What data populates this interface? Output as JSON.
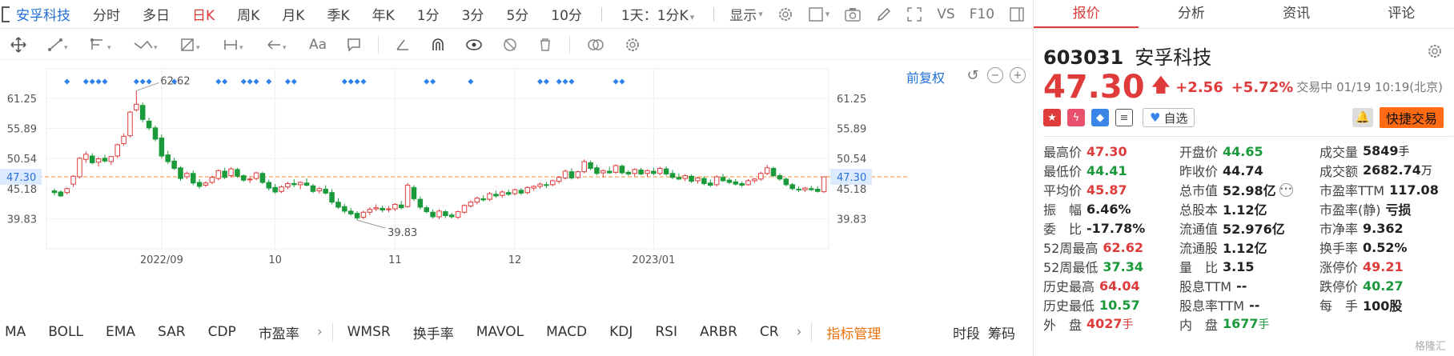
{
  "stock_tab": "安孚科技",
  "periods": [
    "分时",
    "多日",
    "日K",
    "周K",
    "月K",
    "季K",
    "年K",
    "1分",
    "3分",
    "5分",
    "10分",
    "1天：1分K"
  ],
  "active_period": "日K",
  "display_label": "显示",
  "vs_label": "VS",
  "f10_label": "F10",
  "draw_tools": {
    "text_label": "Aa"
  },
  "adj_label": "前复权",
  "indicators": [
    "MA",
    "BOLL",
    "EMA",
    "SAR",
    "CDP",
    "市盈率"
  ],
  "indicators2": [
    "WMSR",
    "换手率",
    "MAVOL",
    "MACD",
    "KDJ",
    "RSI",
    "ARBR",
    "CR"
  ],
  "indicator_manage": "指标管理",
  "bottom_right": [
    "时段",
    "筹码"
  ],
  "right_tabs": [
    "报价",
    "分析",
    "资讯",
    "评论"
  ],
  "quote": {
    "code": "603031",
    "name": "安孚科技",
    "price": "47.30",
    "change": "+2.56",
    "pct": "+5.72%",
    "status": "交易中 01/19 10:19(北京)",
    "favorite": "自选",
    "quick_trade": "快捷交易"
  },
  "stats": [
    [
      {
        "l": "最高价",
        "v": "47.30",
        "c": "red"
      },
      {
        "l": "开盘价",
        "v": "44.65",
        "c": "green"
      },
      {
        "l": "成交量",
        "v": "5849",
        "u": "手"
      }
    ],
    [
      {
        "l": "最低价",
        "v": "44.41",
        "c": "green"
      },
      {
        "l": "昨收价",
        "v": "44.74"
      },
      {
        "l": "成交额",
        "v": "2682.74",
        "u": "万"
      }
    ],
    [
      {
        "l": "平均价",
        "v": "45.87",
        "c": "red"
      },
      {
        "l": "总市值",
        "v": "52.98亿",
        "more": true
      },
      {
        "l": "市盈率TTM",
        "v": "117.08"
      }
    ],
    [
      {
        "l": "振　幅",
        "v": "6.46%"
      },
      {
        "l": "总股本",
        "v": "1.12亿"
      },
      {
        "l": "市盈率(静)",
        "v": "亏损"
      }
    ],
    [
      {
        "l": "委　比",
        "v": "-17.78%"
      },
      {
        "l": "流通值",
        "v": "52.976亿"
      },
      {
        "l": "市净率",
        "v": "9.362"
      }
    ],
    [
      {
        "l": "52周最高",
        "v": "62.62",
        "c": "red"
      },
      {
        "l": "流通股",
        "v": "1.12亿"
      },
      {
        "l": "换手率",
        "v": "0.52%"
      }
    ],
    [
      {
        "l": "52周最低",
        "v": "37.34",
        "c": "green"
      },
      {
        "l": "量　比",
        "v": "3.15"
      },
      {
        "l": "涨停价",
        "v": "49.21",
        "c": "red"
      }
    ],
    [
      {
        "l": "历史最高",
        "v": "64.04",
        "c": "red"
      },
      {
        "l": "股息TTM",
        "v": "--"
      },
      {
        "l": "跌停价",
        "v": "40.27",
        "c": "green"
      }
    ],
    [
      {
        "l": "历史最低",
        "v": "10.57",
        "c": "green"
      },
      {
        "l": "股息率TTM",
        "v": "--"
      },
      {
        "l": "每　手",
        "v": "100股"
      }
    ],
    [
      {
        "l": "外　盘",
        "v": "4027",
        "u": "手",
        "c": "red"
      },
      {
        "l": "内　盘",
        "v": "1677",
        "u": "手",
        "c": "green"
      },
      {
        "l": "",
        "v": ""
      }
    ]
  ],
  "watermark": "格隆汇",
  "chart_data": {
    "type": "candlestick",
    "y_ticks": [
      "61.25",
      "55.89",
      "50.54",
      "45.18",
      "39.83"
    ],
    "x_ticks": [
      "2022/09",
      "10",
      "11",
      "12",
      "2023/01"
    ],
    "current_price_label": "47.30",
    "high_label": "62.62",
    "low_label": "39.83",
    "ylim": [
      34.5,
      66.5
    ],
    "colors": {
      "up": "#e03b3b",
      "down": "#1a9a3a",
      "ref": "#f08c3c",
      "marker": "#2f80ed"
    },
    "candles": [
      [
        44.8,
        45.2,
        44.0,
        44.5
      ],
      [
        44.6,
        44.9,
        43.7,
        43.9
      ],
      [
        44.5,
        45.4,
        44.2,
        45.2
      ],
      [
        46.0,
        47.6,
        45.5,
        47.4
      ],
      [
        47.3,
        50.8,
        47.0,
        50.6
      ],
      [
        50.4,
        51.8,
        49.8,
        51.3
      ],
      [
        51.0,
        51.5,
        49.5,
        49.8
      ],
      [
        49.9,
        50.8,
        49.1,
        50.5
      ],
      [
        50.6,
        51.2,
        49.8,
        50.1
      ],
      [
        50.0,
        51.0,
        49.4,
        50.9
      ],
      [
        51.0,
        53.2,
        50.6,
        53.0
      ],
      [
        53.2,
        55.0,
        52.8,
        54.5
      ],
      [
        54.6,
        59.0,
        54.3,
        58.8
      ],
      [
        59.2,
        62.6,
        58.9,
        60.2
      ],
      [
        60.0,
        60.5,
        57.0,
        57.5
      ],
      [
        57.2,
        57.8,
        55.6,
        56.0
      ],
      [
        56.0,
        56.4,
        53.6,
        54.0
      ],
      [
        54.2,
        54.8,
        50.6,
        51.0
      ],
      [
        51.2,
        51.9,
        49.6,
        50.0
      ],
      [
        50.1,
        50.7,
        48.5,
        48.8
      ],
      [
        48.9,
        49.2,
        46.6,
        47.0
      ],
      [
        47.3,
        48.2,
        46.9,
        47.9
      ],
      [
        47.9,
        48.4,
        45.8,
        46.2
      ],
      [
        46.3,
        46.9,
        45.2,
        45.6
      ],
      [
        45.8,
        46.5,
        45.5,
        46.2
      ],
      [
        46.3,
        47.5,
        46.0,
        47.2
      ],
      [
        47.0,
        48.6,
        46.7,
        48.4
      ],
      [
        48.3,
        48.9,
        46.9,
        47.2
      ],
      [
        47.5,
        49.0,
        47.2,
        48.7
      ],
      [
        48.6,
        48.9,
        47.1,
        47.4
      ],
      [
        47.5,
        47.7,
        46.4,
        46.7
      ],
      [
        46.8,
        47.4,
        46.2,
        46.9
      ],
      [
        47.0,
        48.2,
        46.7,
        48.0
      ],
      [
        47.9,
        48.2,
        46.0,
        46.3
      ],
      [
        46.3,
        46.8,
        44.9,
        45.3
      ],
      [
        45.4,
        46.0,
        44.3,
        44.6
      ],
      [
        44.7,
        45.8,
        44.4,
        45.5
      ],
      [
        45.5,
        46.4,
        45.1,
        46.1
      ],
      [
        46.1,
        46.9,
        45.5,
        45.9
      ],
      [
        45.9,
        46.5,
        45.1,
        46.3
      ],
      [
        46.2,
        47.0,
        45.6,
        45.8
      ],
      [
        45.7,
        46.0,
        44.4,
        44.7
      ],
      [
        44.8,
        45.5,
        44.3,
        45.2
      ],
      [
        45.1,
        45.8,
        44.1,
        44.4
      ],
      [
        44.5,
        45.1,
        42.4,
        42.8
      ],
      [
        42.8,
        43.5,
        41.6,
        41.9
      ],
      [
        42.0,
        42.5,
        40.8,
        41.2
      ],
      [
        41.2,
        41.8,
        40.4,
        40.7
      ],
      [
        40.8,
        41.2,
        39.6,
        40.0
      ],
      [
        40.1,
        41.3,
        39.8,
        41.0
      ],
      [
        41.0,
        41.9,
        40.5,
        41.5
      ],
      [
        41.6,
        42.4,
        41.2,
        41.8
      ],
      [
        41.7,
        42.2,
        41.0,
        41.4
      ],
      [
        41.5,
        42.1,
        41.0,
        41.6
      ],
      [
        41.6,
        42.6,
        41.2,
        42.4
      ],
      [
        42.3,
        43.0,
        41.5,
        41.8
      ],
      [
        42.0,
        46.2,
        41.8,
        45.8
      ],
      [
        45.4,
        45.8,
        43.0,
        43.4
      ],
      [
        43.3,
        43.8,
        41.5,
        41.9
      ],
      [
        41.8,
        42.2,
        40.8,
        41.1
      ],
      [
        41.0,
        41.5,
        39.9,
        40.2
      ],
      [
        40.2,
        41.5,
        39.8,
        41.2
      ],
      [
        41.1,
        41.4,
        40.0,
        40.4
      ],
      [
        40.5,
        40.9,
        39.9,
        40.2
      ],
      [
        40.1,
        41.3,
        39.8,
        41.1
      ],
      [
        41.0,
        42.4,
        40.7,
        42.2
      ],
      [
        42.1,
        43.1,
        41.8,
        42.8
      ],
      [
        42.8,
        43.8,
        42.4,
        43.5
      ],
      [
        43.4,
        44.0,
        42.9,
        43.2
      ],
      [
        43.3,
        44.6,
        43.0,
        44.3
      ],
      [
        44.2,
        44.8,
        43.6,
        43.9
      ],
      [
        44.0,
        44.9,
        43.6,
        44.6
      ],
      [
        44.5,
        45.0,
        43.9,
        44.2
      ],
      [
        44.3,
        45.2,
        44.0,
        45.0
      ],
      [
        44.9,
        45.3,
        44.1,
        44.4
      ],
      [
        44.5,
        45.6,
        44.2,
        45.4
      ],
      [
        45.3,
        45.8,
        44.8,
        45.6
      ],
      [
        45.6,
        46.3,
        45.2,
        46.0
      ],
      [
        45.9,
        46.4,
        45.3,
        45.8
      ],
      [
        45.9,
        46.8,
        45.6,
        46.6
      ],
      [
        46.5,
        47.4,
        46.1,
        47.2
      ],
      [
        47.1,
        48.6,
        46.8,
        48.3
      ],
      [
        48.2,
        48.8,
        46.8,
        47.1
      ],
      [
        47.2,
        48.4,
        46.9,
        48.2
      ],
      [
        48.2,
        50.4,
        47.9,
        50.0
      ],
      [
        49.8,
        50.2,
        48.5,
        48.8
      ],
      [
        48.9,
        49.4,
        47.6,
        47.9
      ],
      [
        48.0,
        48.6,
        47.2,
        48.4
      ],
      [
        48.3,
        49.1,
        47.8,
        48.0
      ],
      [
        48.1,
        49.5,
        47.8,
        49.3
      ],
      [
        49.2,
        49.5,
        47.7,
        48.0
      ],
      [
        48.1,
        48.4,
        47.5,
        47.8
      ],
      [
        47.9,
        48.8,
        47.4,
        48.6
      ],
      [
        48.5,
        48.9,
        47.6,
        47.8
      ],
      [
        47.9,
        48.6,
        47.3,
        48.4
      ],
      [
        48.3,
        48.9,
        47.6,
        47.9
      ],
      [
        47.9,
        49.1,
        47.6,
        48.8
      ],
      [
        48.7,
        49.2,
        47.5,
        47.8
      ],
      [
        47.9,
        48.5,
        46.9,
        47.2
      ],
      [
        47.2,
        47.9,
        46.7,
        46.9
      ],
      [
        47.0,
        47.8,
        46.5,
        47.5
      ],
      [
        47.4,
        47.7,
        46.2,
        46.5
      ],
      [
        46.6,
        47.3,
        46.1,
        47.1
      ],
      [
        47.0,
        47.4,
        45.8,
        46.1
      ],
      [
        46.2,
        46.8,
        45.5,
        45.8
      ],
      [
        45.9,
        47.6,
        45.6,
        47.3
      ],
      [
        47.2,
        47.8,
        46.4,
        46.6
      ],
      [
        46.7,
        47.1,
        46.0,
        46.3
      ],
      [
        46.4,
        46.9,
        45.7,
        46.0
      ],
      [
        46.1,
        46.5,
        45.5,
        45.8
      ],
      [
        45.9,
        46.9,
        45.7,
        46.6
      ],
      [
        46.6,
        47.1,
        46.2,
        46.9
      ],
      [
        46.9,
        48.2,
        46.6,
        47.9
      ],
      [
        47.9,
        49.4,
        47.6,
        48.9
      ],
      [
        48.8,
        49.1,
        47.2,
        47.5
      ],
      [
        47.5,
        47.9,
        46.6,
        46.9
      ],
      [
        46.9,
        47.2,
        45.6,
        45.9
      ],
      [
        45.9,
        46.2,
        44.9,
        45.2
      ],
      [
        45.1,
        45.6,
        44.6,
        45.0
      ],
      [
        45.0,
        45.5,
        44.6,
        45.3
      ],
      [
        45.2,
        45.7,
        44.8,
        45.0
      ],
      [
        45.1,
        45.6,
        44.5,
        44.7
      ],
      [
        44.65,
        47.3,
        44.41,
        47.3
      ]
    ],
    "markers": [
      2,
      5,
      6,
      7,
      8,
      13,
      14,
      15,
      19,
      26,
      27,
      30,
      31,
      32,
      34,
      37,
      38,
      46,
      47,
      48,
      49,
      59,
      60,
      66,
      77,
      78,
      80,
      81,
      82,
      89,
      90
    ]
  }
}
